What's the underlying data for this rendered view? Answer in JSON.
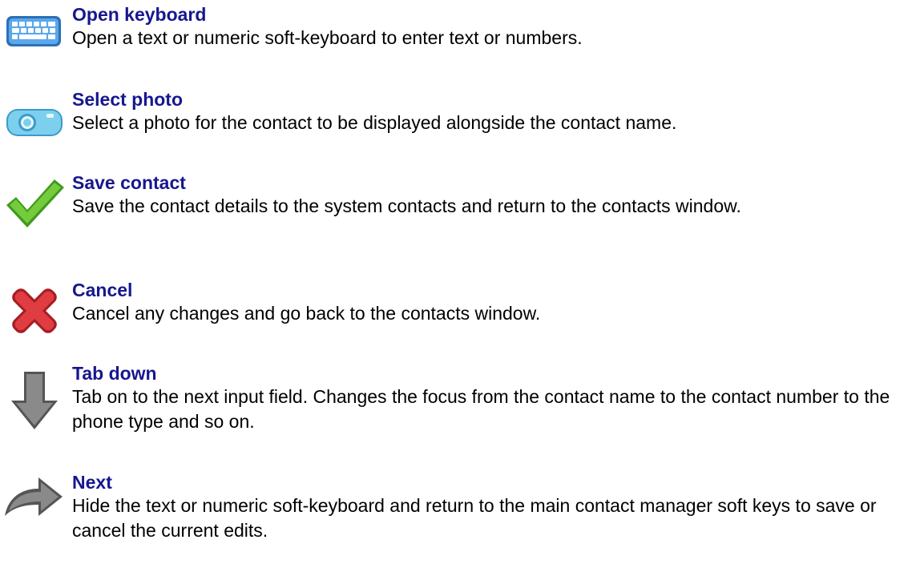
{
  "items": [
    {
      "title": "Open keyboard",
      "description": "Open a text or numeric soft-keyboard to enter text or numbers.",
      "icon": "keyboard-icon"
    },
    {
      "title": "Select photo",
      "description": "Select a photo for the contact  to be displayed alongside the contact name.",
      "icon": "camera-icon"
    },
    {
      "title": "Save contact",
      "description": "Save the contact details to the system contacts and return to the contacts window.",
      "icon": "checkmark-icon"
    },
    {
      "title": "Cancel",
      "description": "Cancel any changes and go back to the contacts window.",
      "icon": "cross-icon"
    },
    {
      "title": "Tab down",
      "description": "Tab on to the next input field. Changes the focus from the contact name to the contact number to the phone type and so on.",
      "icon": "arrow-down-icon"
    },
    {
      "title": "Next",
      "description": "Hide the text or numeric soft-keyboard and return to the main contact manager soft keys to save or cancel the current edits.",
      "icon": "arrow-forward-icon"
    }
  ],
  "colors": {
    "title": "#17178f",
    "text": "#000000",
    "keyboard": "#3f8fd8",
    "camera": "#4fb4dc",
    "check": "#5cb82e",
    "cross": "#c8282d",
    "arrow": "#6a6a6a"
  }
}
